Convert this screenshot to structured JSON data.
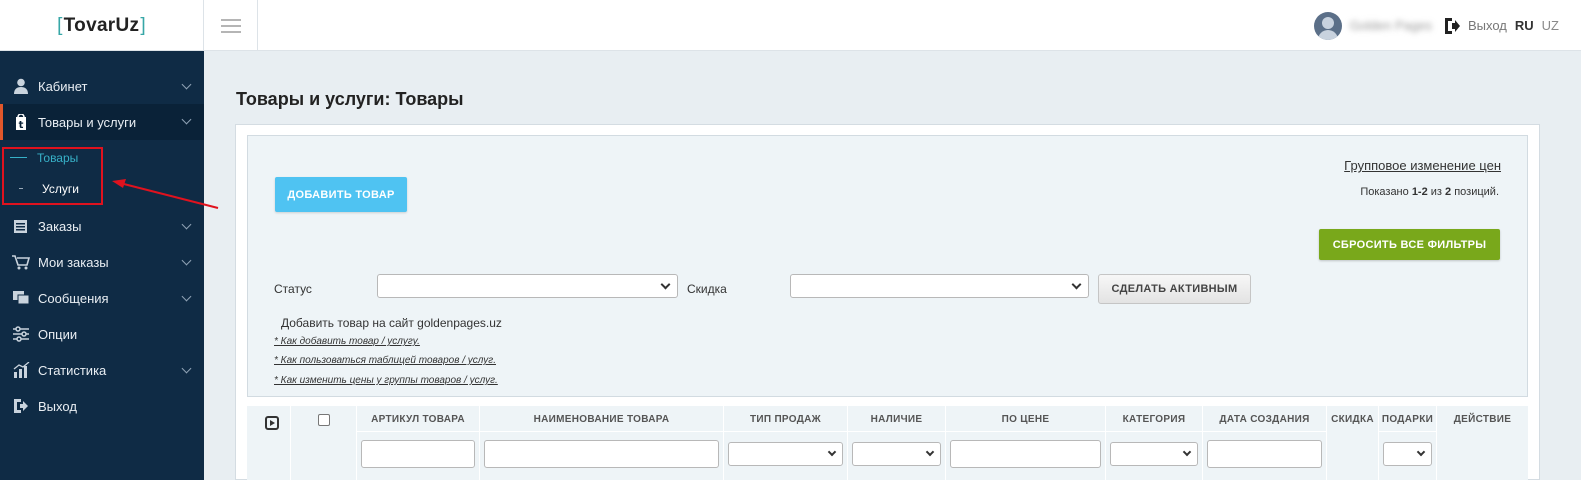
{
  "header": {
    "logo": "TovarUz",
    "user_name": "Golden Pages",
    "logout_label": "Выход",
    "languages": [
      {
        "code": "RU",
        "active": true
      },
      {
        "code": "UZ",
        "active": false
      }
    ]
  },
  "sidebar": {
    "items": [
      {
        "label": "Кабинет",
        "icon": "user-icon",
        "has_submenu": true
      },
      {
        "label": "Товары и услуги",
        "icon": "tag-icon",
        "has_submenu": true,
        "active": true,
        "subitems": [
          {
            "label": "Товары",
            "current": true
          },
          {
            "label": "Услуги",
            "current": false
          }
        ]
      },
      {
        "label": "Заказы",
        "icon": "orders-icon",
        "has_submenu": true
      },
      {
        "label": "Мои заказы",
        "icon": "cart-icon",
        "has_submenu": true
      },
      {
        "label": "Сообщения",
        "icon": "messages-icon",
        "has_submenu": true
      },
      {
        "label": "Опции",
        "icon": "sliders-icon",
        "has_submenu": false
      },
      {
        "label": "Статистика",
        "icon": "chart-icon",
        "has_submenu": true
      },
      {
        "label": "Выход",
        "icon": "exit-icon",
        "has_submenu": false
      }
    ]
  },
  "main": {
    "page_title": "Товары и услуги: Товары",
    "group_price_link": "Групповое изменение цен",
    "add_button": "ДОБАВИТЬ ТОВАР",
    "shown_prefix": "Показано ",
    "shown_range": "1-2",
    "shown_middle": " из ",
    "shown_total": "2",
    "shown_suffix": " позиций.",
    "reset_button": "СБРОСИТЬ ВСЕ ФИЛЬТРЫ",
    "status_label": "Статус",
    "status_value": "",
    "discount_label": "Скидка",
    "discount_value": "",
    "activate_button": "СДЕЛАТЬ АКТИВНЫМ",
    "add_site_text": "Добавить товар на сайт goldenpages.uz",
    "help_links": [
      "* Как добавить товар / услугу.",
      "* Как пользоваться таблицей товаров / услуг.",
      "* Как изменить цены у группы товаров / услуг."
    ]
  },
  "table": {
    "columns": [
      {
        "key": "play",
        "label": ""
      },
      {
        "key": "check",
        "label": ""
      },
      {
        "key": "sku",
        "label": "АРТИКУЛ ТОВАРА"
      },
      {
        "key": "name",
        "label": "НАИМЕНОВАНИЕ ТОВАРА"
      },
      {
        "key": "sale_type",
        "label": "ТИП ПРОДАЖ"
      },
      {
        "key": "availability",
        "label": "НАЛИЧИЕ"
      },
      {
        "key": "price",
        "label": "ПО ЦЕНЕ"
      },
      {
        "key": "category",
        "label": "КАТЕГОРИЯ"
      },
      {
        "key": "created",
        "label": "ДАТА СОЗДАНИЯ"
      },
      {
        "key": "discount",
        "label": "СКИДКА"
      },
      {
        "key": "gifts",
        "label": "ПОДАРКИ"
      },
      {
        "key": "action",
        "label": "ДЕЙСТВИЕ"
      }
    ]
  }
}
